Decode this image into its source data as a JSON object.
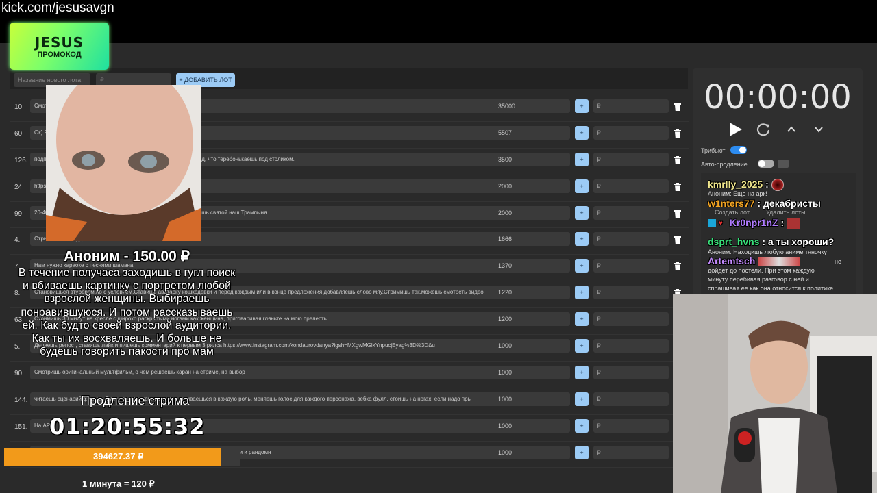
{
  "url": "kick.com/jesusavgn",
  "promo": {
    "title": "JESUS",
    "subtitle": "ПРОМОКОД"
  },
  "new_lot": {
    "name_placeholder": "Название нового лота",
    "price_placeholder": "₽",
    "add_label": "+ ДОБАВИТЬ ЛОТ"
  },
  "lots": [
    {
      "num": "10.",
      "desc": "Смотр                                                                          нут.",
      "amount": "35000",
      "plus": "+",
      "rub": "₽"
    },
    {
      "num": "60.",
      "desc": "Ок) Р",
      "amount": "5507",
      "plus": "+",
      "rub": "₽"
    },
    {
      "num": "126.",
      "desc": "подп                                                          аешь посты и сторис лайкая и коментируя. Иногда делай вид, что теребонькаешь под столиком.",
      "amount": "3500",
      "plus": "+",
      "rub": "₽"
    },
    {
      "num": "24.",
      "desc": "https:",
      "amount": "2000",
      "plus": "+",
      "rub": "₽"
    },
    {
      "num": "99.",
      "desc": "20-40                                                          кий рок стоя и встаешь на колени, молишься и потом кричишь святой наш Трампыня",
      "amount": "2000",
      "plus": "+",
      "rub": "₽"
    },
    {
      "num": "4.",
      "desc": "Стримишь не поддакивая во чатами",
      "amount": "1666",
      "plus": "+",
      "rub": "₽"
    },
    {
      "num": "7.",
      "desc": "Нам нужно караоке с песнями шамана",
      "amount": "1370",
      "plus": "+",
      "rub": "₽"
    },
    {
      "num": "8.",
      "desc": "Становишься втубером,но с условием.Ставишь аватарку кошкодевки и перед каждым или в конце предложения добавляешь слово мяу.Стримишь так,можешь смотреть видео",
      "amount": "1220",
      "plus": "+",
      "rub": "₽"
    },
    {
      "num": "63.",
      "desc": "Стримишь 30 минут на кресле с широко раскрытыми ногами как женщина, приговаривая гляньте на мою прелесть",
      "amount": "1200",
      "plus": "+",
      "rub": "₽"
    },
    {
      "num": "5.",
      "desc": "Делаешь репост, ставишь лайк и пишешь комментарий к первым 3 рилса https://www.instagram.com/kondaurovdanya?igsh=MXgwMGlxYnpucjEyag%3D%3D&u",
      "amount": "1000",
      "plus": "+",
      "rub": "₽"
    },
    {
      "num": "90.",
      "desc": "Смотришь оригинальный мультфильм, о чём решаешь каран на стриме, на выбор",
      "amount": "1000",
      "plus": "+",
      "rub": "₽"
    },
    {
      "num": "144.",
      "desc": "читаешь сценарий фильма Сумерки и отыгрываешь его, вживаешься в каждую роль, меняешь голос для каждого персонажа, вебка фулл, стоишь на ногах, если надо пры",
      "amount": "1000",
      "plus": "+",
      "rub": "₽"
    },
    {
      "num": "151.",
      "desc": "На АР",
      "amount": "1000",
      "plus": "+",
      "rub": "₽"
    },
    {
      "num": "",
      "desc": "                                                                стер , обсуждаешь его с чатом и с чат гпт, нахваливать идею этого аниме и манги и рандомн",
      "amount": "1000",
      "plus": "+",
      "rub": "₽"
    }
  ],
  "timer": {
    "display": "00:00:00",
    "tribute_label": "Трибьют",
    "auto_ext_label": "Авто-продление",
    "dots": "..."
  },
  "chat": {
    "messages": [
      {
        "user": "kmrlly_2025",
        "sep": ":",
        "text": "",
        "color": "#f0e68c"
      },
      {
        "user": "w1nters77",
        "sep": ":",
        "text": "декабристы",
        "color": "#f5a623"
      },
      {
        "user": "Kr0npr1nZ",
        "sep": ":",
        "text": "",
        "color": "#b07cff"
      },
      {
        "user": "dsprt_hvns",
        "sep": ":",
        "text": "а ты хороши?",
        "color": "#39e07a"
      },
      {
        "user": "Artemtsch",
        "sep": "",
        "text": "",
        "color": "#c58bff"
      }
    ],
    "under_1": "Аноним: Еще на арк!",
    "under_2a": "Создать лот",
    "under_2b": "Удалить лоты",
    "under_4": "Аноним: Находишь любую аниме тяночку",
    "under_5": "не",
    "under_6": "дойдет до постели. При этом каждую",
    "under_7": "минуту перебивая разговор с ней и",
    "under_8": "спрашивая ее как она относится к политике"
  },
  "donation": {
    "name": "Аноним - 150.00 ₽",
    "text": "В течение получаса заходишь в гугл поиск и вбиваешь картинку с портретом любой взрослой женщины. Выбираешь понравившуюся. И потом рассказываешь ей. Как будто своей взрослой аудитории. Как ты их восхваляешь. И больше не будешь говорить пакости про мам"
  },
  "extension": {
    "label": "Продление стрима",
    "time": "01:20:55:32",
    "progress_text": "394627.37 ₽",
    "progress_fraction": 0.92,
    "rate": "1 минута = 120 ₽"
  },
  "colors": {
    "accent": "#9ccbf5",
    "toggle_on": "#2d8cf0",
    "progress": "#f29a1a",
    "promo": "#7cff6a"
  }
}
